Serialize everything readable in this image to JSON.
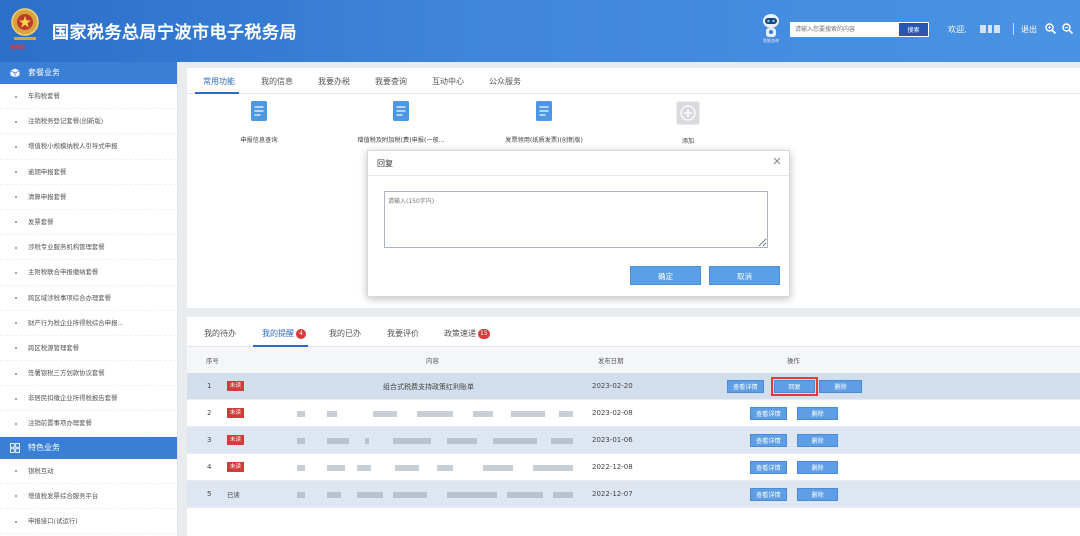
{
  "header": {
    "title": "国家税务总局宁波市电子税务局",
    "emblem_caption": "税务局",
    "robot_label": "智能咨询",
    "search_placeholder": "请输入您要搜索的内容",
    "search_label": "搜索",
    "welcome": "欢迎,",
    "logout": "退出"
  },
  "sidebar": {
    "section1": "套餐业务",
    "items1": [
      "车购税套餐",
      "注销税务登记套餐(创新版)",
      "增值税小规模纳税人引导式申报",
      "逾期申报套餐",
      "清算申报套餐",
      "发票套餐",
      "涉税专业服务机构管理套餐",
      "主附税联合申报缴纳套餐",
      "跨区域涉税事项综合办理套餐",
      "财产行为税企业所得税综合申报...",
      "跨区税源管理套餐",
      "签署银税三方划款协议套餐",
      "非居民扣缴企业所得税报告套餐",
      "注销前置事项办理套餐"
    ],
    "section2": "特色业务",
    "items2": [
      "银税互动",
      "增值税发票综合服务平台",
      "申报接口(试运行)"
    ]
  },
  "top_tabs": [
    "常用功能",
    "我的信息",
    "我要办税",
    "我要查询",
    "互动中心",
    "公众服务"
  ],
  "shortcuts": [
    "申报信息查询",
    "增值税及附加税(费)申报(一般...",
    "发票领用(纸质发票)(创新版)",
    "添加"
  ],
  "bottom_tabs": {
    "t1": "我的待办",
    "t2": "我的提醒",
    "t2_badge": "4",
    "t3": "我的已办",
    "t4": "我要评价",
    "t5": "政策速递",
    "t5_badge": "15"
  },
  "table": {
    "col_no": "序号",
    "col_content": "内容",
    "col_date": "发布日期",
    "col_action": "操作",
    "view_label": "查看详情",
    "reply_label": "回复",
    "delete_label": "删除",
    "rows": [
      {
        "no": "1",
        "status": "未读",
        "content": "组合式税费支持政策红利账单",
        "date": "2023-02-20"
      },
      {
        "no": "2",
        "status": "未读",
        "content": "",
        "date": "2023-02-08"
      },
      {
        "no": "3",
        "status": "未读",
        "content": "",
        "date": "2023-01-06"
      },
      {
        "no": "4",
        "status": "未读",
        "content": "",
        "date": "2022-12-08"
      },
      {
        "no": "5",
        "status": "已读",
        "content": "",
        "date": "2022-12-07"
      }
    ]
  },
  "modal": {
    "title": "回复",
    "placeholder": "请输入(150字内)",
    "confirm": "确定",
    "cancel": "取消"
  },
  "colors": {
    "header_blue": "#3f86dc",
    "accent_blue": "#2b6cc4",
    "button_blue": "#5aa0e6",
    "unread_red": "#d33a3a",
    "highlight_red": "#e23b3b"
  }
}
